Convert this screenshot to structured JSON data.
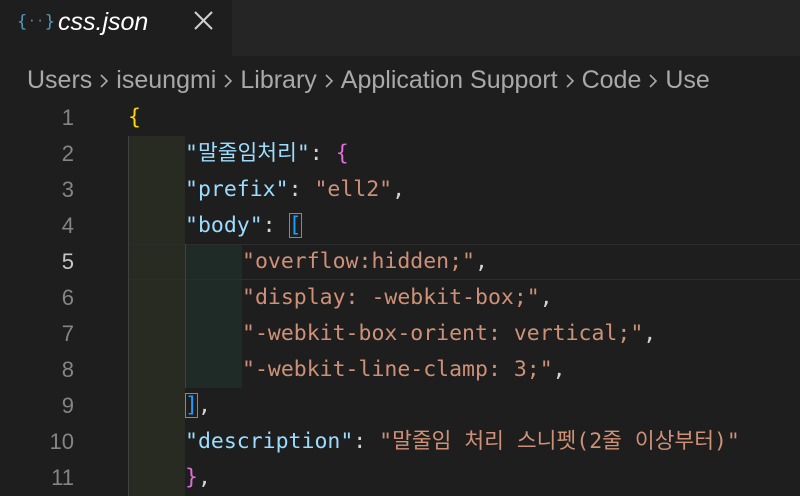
{
  "tab": {
    "icon": "json-braces-icon",
    "title": "css.json"
  },
  "breadcrumb": [
    "Users",
    "iseungmi",
    "Library",
    "Application Support",
    "Code",
    "Use"
  ],
  "editor": {
    "line_numbers": [
      "1",
      "2",
      "3",
      "4",
      "5",
      "6",
      "7",
      "8",
      "9",
      "10",
      "11"
    ],
    "active_line": "5",
    "snippet_name": "\"말줄임처리\"",
    "prefix_key": "\"prefix\"",
    "prefix_value": "\"ell2\"",
    "body_key": "\"body\"",
    "body_lines": [
      "\"overflow:hidden;\"",
      "\"display: -webkit-box;\"",
      "\"-webkit-box-orient: vertical;\"",
      "\"-webkit-line-clamp: 3;\""
    ],
    "description_key": "\"description\"",
    "description_value": "\"말줄임 처리 스니펫(2줄 이상부터)\""
  },
  "colors": {
    "background": "#1e1e1e",
    "key": "#9cdcfe",
    "string": "#ce9178",
    "brace_level1": "#ffd700",
    "brace_level2": "#da70d6",
    "brace_level3": "#179fff"
  }
}
